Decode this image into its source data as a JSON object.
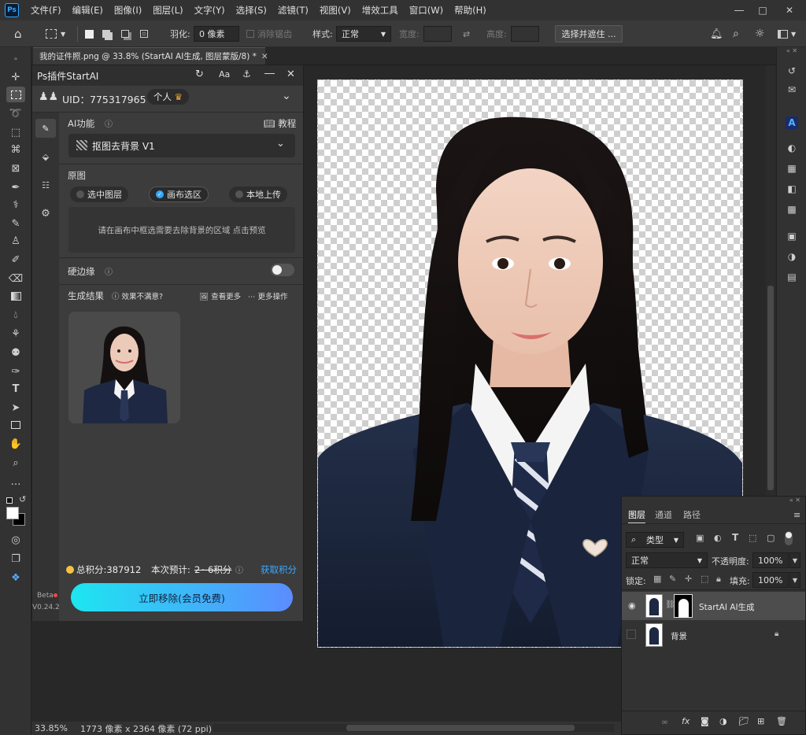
{
  "menubar": {
    "items": [
      "文件(F)",
      "编辑(E)",
      "图像(I)",
      "图层(L)",
      "文字(Y)",
      "选择(S)",
      "滤镜(T)",
      "视图(V)",
      "增效工具",
      "窗口(W)",
      "帮助(H)"
    ]
  },
  "options": {
    "feather_label": "羽化:",
    "feather_value": "0 像素",
    "antialias_label": "消除锯齿",
    "style_label": "样式:",
    "style_value": "正常",
    "width_label": "宽度:",
    "height_label": "高度:",
    "select_mask_button": "选择并遮住 ..."
  },
  "document": {
    "tab_title": "我的证件照.png @ 33.8% (StartAI AI生成, 图层蒙版/8) *"
  },
  "plugin": {
    "title": "Ps插件StartAI",
    "lang_button": "Aa",
    "uid": "UID：775317965",
    "account_badge": "个人",
    "ai_func_label": "AI功能",
    "tutorial_label": "教程",
    "function_select": "抠图去背景 V1",
    "source_label": "原图",
    "source_options": [
      "选中图层",
      "画布选区",
      "本地上传"
    ],
    "hint_text": "请在画布中框选需要去除背景的区域 点击预览",
    "hard_edge_label": "硬边缘",
    "result_label": "生成结果",
    "unsatisfied_label": "效果不满意?",
    "see_more": "查看更多",
    "more_actions": "更多操作",
    "points_label": "总积分:387912",
    "cost_prefix": "本次预计:",
    "cost_value": "2~6积分",
    "get_points": "获取积分",
    "remove_button": "立即移除(会员免费)",
    "beta_label": "Beta",
    "version_label": "V0.24.2"
  },
  "layers_panel": {
    "tabs": [
      "图层",
      "通道",
      "路径"
    ],
    "filter_kind": "类型",
    "blend_mode": "正常",
    "opacity_label": "不透明度:",
    "opacity_value": "100%",
    "lock_label": "锁定:",
    "fill_label": "填充:",
    "fill_value": "100%",
    "layers": [
      {
        "name": "StartAI AI生成"
      },
      {
        "name": "背景"
      }
    ]
  },
  "status": {
    "zoom": "33.85%",
    "doc_info": "1773 像素 x 2364 像素 (72 ppi)"
  },
  "colors": {
    "accent_blue": "#31a8ff",
    "gradient_start": "#1de6f0",
    "gradient_end": "#5b8cff",
    "link_blue": "#3aa8ff",
    "coin_yellow": "#f5c242"
  }
}
